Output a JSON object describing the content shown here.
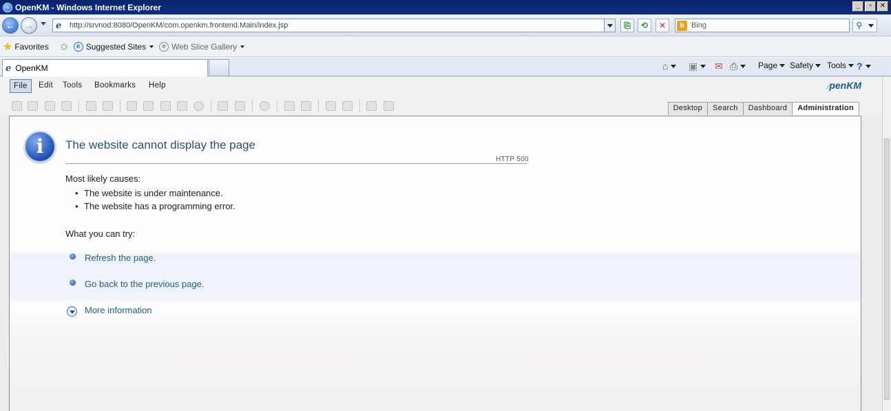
{
  "browser": {
    "window_title": "OpenKM - Windows Internet Explorer",
    "url": "http://srvnod:8080/OpenKM/com.openkm.frontend.Main/index.jsp",
    "search_placeholder": "Bing",
    "favorites_label": "Favorites",
    "suggested_sites_label": "Suggested Sites",
    "web_slice_label": "Web Slice Gallery",
    "tab_title": "OpenKM",
    "commands": {
      "page": "Page",
      "safety": "Safety",
      "tools": "Tools"
    }
  },
  "app": {
    "logo_text": "penKM",
    "menu": [
      "File",
      "Edit",
      "Tools",
      "Bookmarks",
      "Help"
    ],
    "view_tabs": [
      "Desktop",
      "Search",
      "Dashboard",
      "Administration"
    ],
    "selected_view_tab": "Administration"
  },
  "error_page": {
    "title": "The website cannot display the page",
    "code": "HTTP 500",
    "causes_heading": "Most likely causes:",
    "causes": [
      "The website is under maintenance.",
      "The website has a programming error."
    ],
    "try_heading": "What you can try:",
    "actions": [
      "Refresh the page.",
      "Go back to the previous page."
    ],
    "more_info": "More information"
  }
}
